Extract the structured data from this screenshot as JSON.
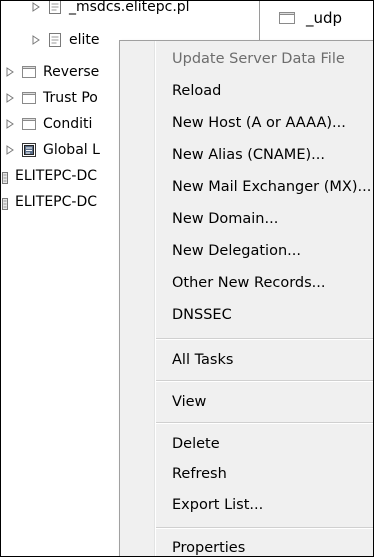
{
  "tree": {
    "items": [
      {
        "label": "_msdcs.elitepc.pl",
        "icon": "zone-file-icon",
        "expander": "collapsed"
      },
      {
        "label": "elite",
        "icon": "zone-file-icon",
        "expander": "collapsed",
        "selected": true
      },
      {
        "label": "Reverse",
        "icon": "folder-icon",
        "expander": "collapsed"
      },
      {
        "label": "Trust Po",
        "icon": "folder-icon",
        "expander": "collapsed"
      },
      {
        "label": "Conditi",
        "icon": "folder-icon",
        "expander": "collapsed"
      },
      {
        "label": "Global L",
        "icon": "global-log-icon",
        "expander": "collapsed"
      },
      {
        "label": "ELITEPC-DC",
        "icon": "server-log-icon"
      },
      {
        "label": "ELITEPC-DC",
        "icon": "server-log-icon"
      }
    ]
  },
  "right_pane": {
    "items": [
      {
        "label": "_udp",
        "icon": "folder-icon"
      }
    ]
  },
  "context_menu": {
    "items": [
      {
        "label": "Update Server Data File",
        "disabled": true
      },
      {
        "label": "Reload"
      },
      {
        "label": "New Host (A or AAAA)..."
      },
      {
        "label": "New Alias (CNAME)..."
      },
      {
        "label": "New Mail Exchanger (MX)..."
      },
      {
        "label": "New Domain..."
      },
      {
        "label": "New Delegation..."
      },
      {
        "label": "Other New Records..."
      },
      {
        "label": "DNSSEC"
      },
      {
        "label": "All Tasks"
      },
      {
        "label": "View"
      },
      {
        "label": "Delete"
      },
      {
        "label": "Refresh"
      },
      {
        "label": "Export List..."
      },
      {
        "label": "Properties"
      }
    ]
  },
  "colors": {
    "menu_background": "#f0f0f0",
    "disabled_text": "#6d6d6d",
    "text": "#000000",
    "frame_border": "#000000"
  }
}
